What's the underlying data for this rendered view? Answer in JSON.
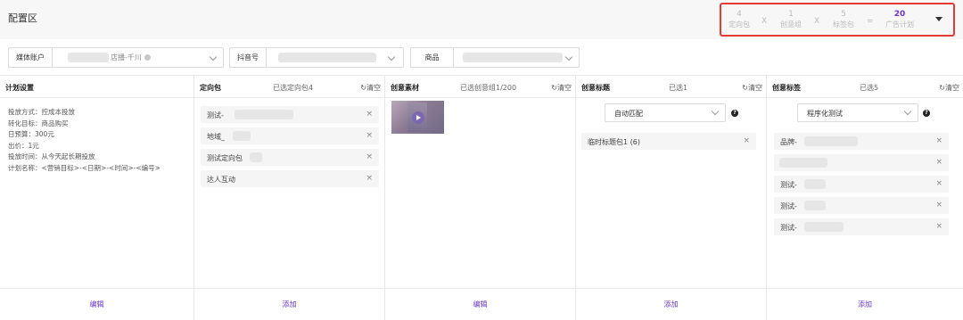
{
  "header": {
    "title": "配置区",
    "summary": [
      {
        "num": "4",
        "label": "定向包"
      },
      {
        "num": "1",
        "label": "创意组"
      },
      {
        "num": "5",
        "label": "标签包"
      },
      {
        "num": "20",
        "label": "广告计划"
      }
    ],
    "op_multiply": "X",
    "op_equals": "="
  },
  "filters": {
    "media_label": "媒体账户",
    "media_value": "店播-千川",
    "douyin_label": "抖音号",
    "product_label": "商品"
  },
  "plan": {
    "title": "计划设置",
    "lines": [
      "投放方式：控成本投放",
      "转化目标：商品购买",
      "日预算：300元",
      "出价：1元",
      "投放时间：从今天起长期投放",
      "计划名称：<营销目标>-<日期>-<时间>-<编号>"
    ],
    "footer": "编辑"
  },
  "targeting": {
    "title": "定向包",
    "count": "已选定向包4",
    "clear": "清空",
    "items": [
      "测试-",
      "地域_",
      "测试定向包",
      "达人互动"
    ],
    "footer": "添加"
  },
  "material": {
    "title": "创意素材",
    "count": "已选创意组1/200",
    "clear": "清空",
    "footer": "编辑"
  },
  "creative_title": {
    "title": "创意标题",
    "count": "已选1",
    "clear": "清空",
    "select": "自动匹配",
    "items": [
      "临时标题包1 (6)"
    ],
    "footer": "添加"
  },
  "creative_tag": {
    "title": "创意标签",
    "count": "已选5",
    "clear": "清空",
    "select": "程序化测试",
    "items": [
      "品牌-",
      "",
      "测试-",
      "测试-",
      "测试-"
    ],
    "footer": "添加"
  },
  "icons": {
    "close": "×",
    "clear": "↻",
    "help": "?"
  },
  "colors": {
    "accent": "#6a35c8",
    "highlight_border": "#e53935"
  }
}
